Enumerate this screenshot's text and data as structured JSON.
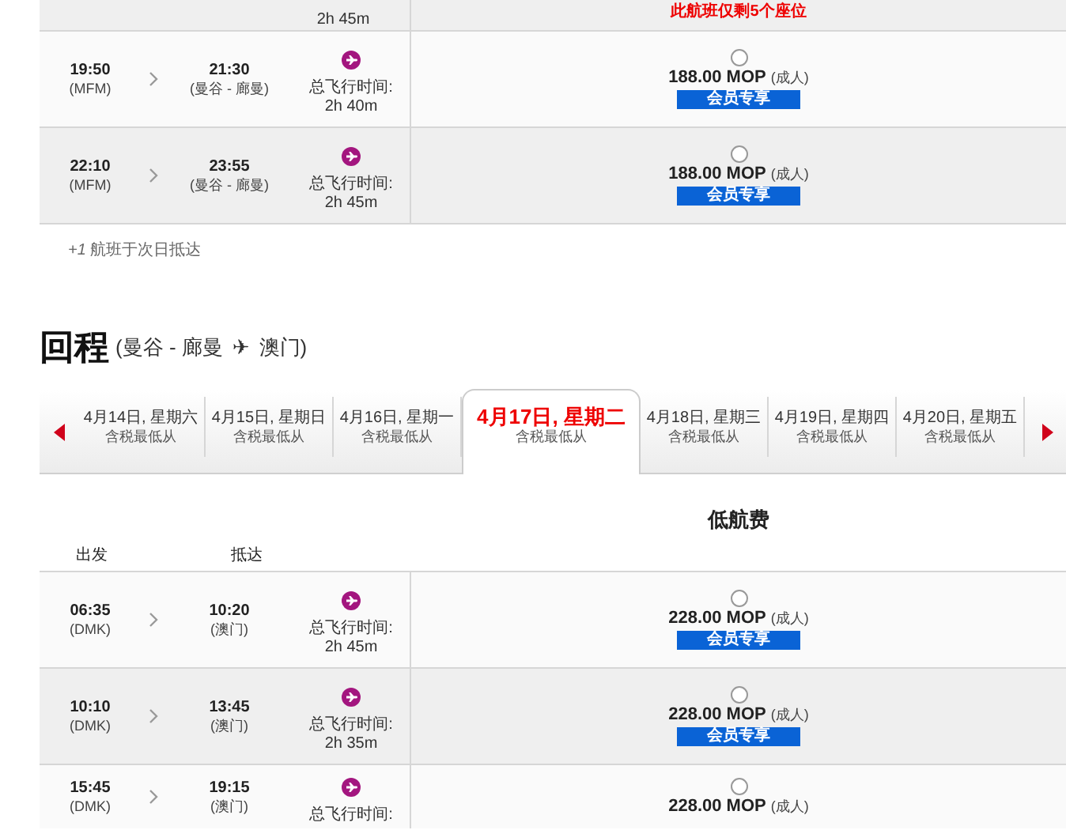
{
  "outbound_tail": {
    "duration": "2h 45m",
    "notice": "此航班仅剩5个座位"
  },
  "outbound_flights": [
    {
      "depart": "19:50",
      "depart_airport": "(MFM)",
      "arrive": "21:30",
      "arrive_airport": "(曼谷 - 廊曼)",
      "duration_label": "总飞行时间:",
      "duration": "2h 40m",
      "price": "188.00 MOP",
      "passenger": "(成人)",
      "badge": "会员专享",
      "selected": false
    },
    {
      "depart": "22:10",
      "depart_airport": "(MFM)",
      "arrive": "23:55",
      "arrive_airport": "(曼谷 - 廊曼)",
      "duration_label": "总飞行时间:",
      "duration": "2h 45m",
      "price": "188.00 MOP",
      "passenger": "(成人)",
      "badge": "会员专享",
      "selected": false
    }
  ],
  "footnote": "*+1* 航班于次日抵达",
  "return": {
    "title": "回程",
    "route_from": "(曼谷 - 廊曼",
    "route_symbol": "✈",
    "route_to": "澳门)"
  },
  "date_tabs": [
    {
      "date": "4月14日, 星期六",
      "sub": "含税最低从",
      "selected": false
    },
    {
      "date": "4月15日, 星期日",
      "sub": "含税最低从",
      "selected": false
    },
    {
      "date": "4月16日, 星期一",
      "sub": "含税最低从",
      "selected": false
    },
    {
      "date": "4月17日, 星期二",
      "sub": "含税最低从",
      "selected": true
    },
    {
      "date": "4月18日, 星期三",
      "sub": "含税最低从",
      "selected": false
    },
    {
      "date": "4月19日, 星期四",
      "sub": "含税最低从",
      "selected": false
    },
    {
      "date": "4月20日, 星期五",
      "sub": "含税最低从",
      "selected": false
    }
  ],
  "fare_header": "低航费",
  "columns": [
    "出发",
    "抵达"
  ],
  "return_flights": [
    {
      "depart": "06:35",
      "depart_airport": "(DMK)",
      "arrive": "10:20",
      "arrive_airport": "(澳门)",
      "duration_label": "总飞行时间:",
      "duration": "2h 45m",
      "price": "228.00 MOP",
      "passenger": "(成人)",
      "badge": "会员专享",
      "selected": false
    },
    {
      "depart": "10:10",
      "depart_airport": "(DMK)",
      "arrive": "13:45",
      "arrive_airport": "(澳门)",
      "duration_label": "总飞行时间:",
      "duration": "2h 35m",
      "price": "228.00 MOP",
      "passenger": "(成人)",
      "badge": "会员专享",
      "selected": false
    },
    {
      "depart": "15:45",
      "depart_airport": "(DMK)",
      "arrive": "19:15",
      "arrive_airport": "(澳门)",
      "duration_label": "总飞行时间:",
      "price": "228.00 MOP",
      "passenger": "(成人)",
      "selected": false
    }
  ]
}
